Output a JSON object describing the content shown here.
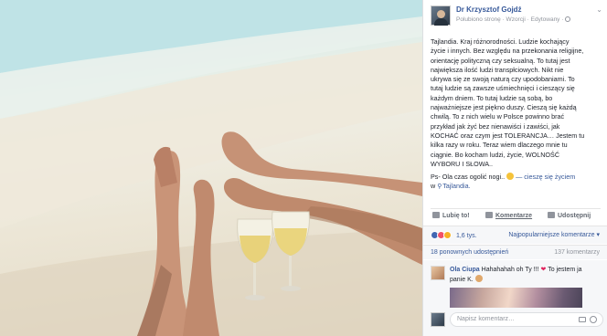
{
  "post": {
    "author": "Dr Krzysztof Gojdź",
    "meta": "Polubiono stronę · Wzorcji · Edytowany ·",
    "body_lines": [
      "Tajlandia. Kraj różnorodności. Ludzie kochający",
      "życie i innych. Bez względu na przekonania religijne,",
      "orientację polityczną czy seksualną. To tutaj jest",
      "największa ilość ludzi transpłciowych. Nikt nie",
      "ukrywa się ze swoją naturą czy upodobaniami. To",
      "tutaj ludzie są zawsze uśmiechnięci i cieszący się",
      "każdym dniem. To tutaj ludzie są sobą, bo",
      "najważniejsze jest piękno duszy. Cieszą się każdą",
      "chwilą. To z nich wielu w Polsce powinno brać",
      "przykład jak żyć bez nienawiści i zawiści, jak",
      "KOCHAĆ oraz czym jest TOLERANCJA… Jestem tu",
      "kilka razy w roku. Teraz wiem dlaczego mnie tu",
      "ciągnie. Bo kocham ludzi, życie, WOLNOŚĆ",
      "WYBORU I SŁOWA.."
    ],
    "ps_text": "Ps- Ola czas ogolić nogi..",
    "feeling": "— cieszę się życiem",
    "location_prefix": "w",
    "location": "Tajlandia."
  },
  "actions": {
    "like": "Lubię to!",
    "comment": "Komentarze",
    "share": "Udostępnij"
  },
  "stats": {
    "reactions_count": "1,6 tys.",
    "sort_label": "Najpopularniejsze komentarze ▾",
    "shares": "18 ponownych udostępnień",
    "comments_count": "137 komentarzy"
  },
  "comment": {
    "author": "Ola Ciupa",
    "text": "Hahahahah oh Ty !!!",
    "text2": "To jestem ja",
    "text3": "panie K."
  },
  "reply": {
    "placeholder": "Napisz komentarz…"
  },
  "colors": {
    "link": "#365899",
    "like": "#4267b2",
    "love": "#f25268",
    "haha": "#f7b125"
  }
}
